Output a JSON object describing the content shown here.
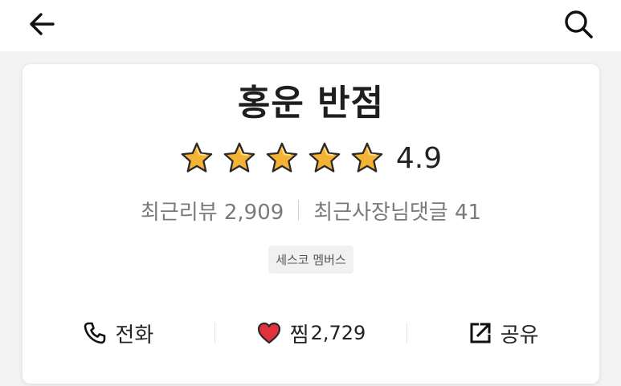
{
  "header": {
    "back_icon": "arrow-left-icon",
    "search_icon": "search-icon"
  },
  "store": {
    "name": "홍운 반점",
    "rating": "4.9",
    "rating_stars": 5,
    "star_color": "#f5b335",
    "review_label": "최근리뷰",
    "review_count": "2,909",
    "owner_reply_label": "최근사장님댓글",
    "owner_reply_count": "41",
    "badge": "세스코 멤버스"
  },
  "actions": {
    "call_label": "전화",
    "call_icon": "phone-icon",
    "jjim_label": "찜",
    "jjim_count": "2,729",
    "jjim_icon": "heart-icon",
    "heart_color": "#e0323c",
    "share_label": "공유",
    "share_icon": "share-icon"
  }
}
